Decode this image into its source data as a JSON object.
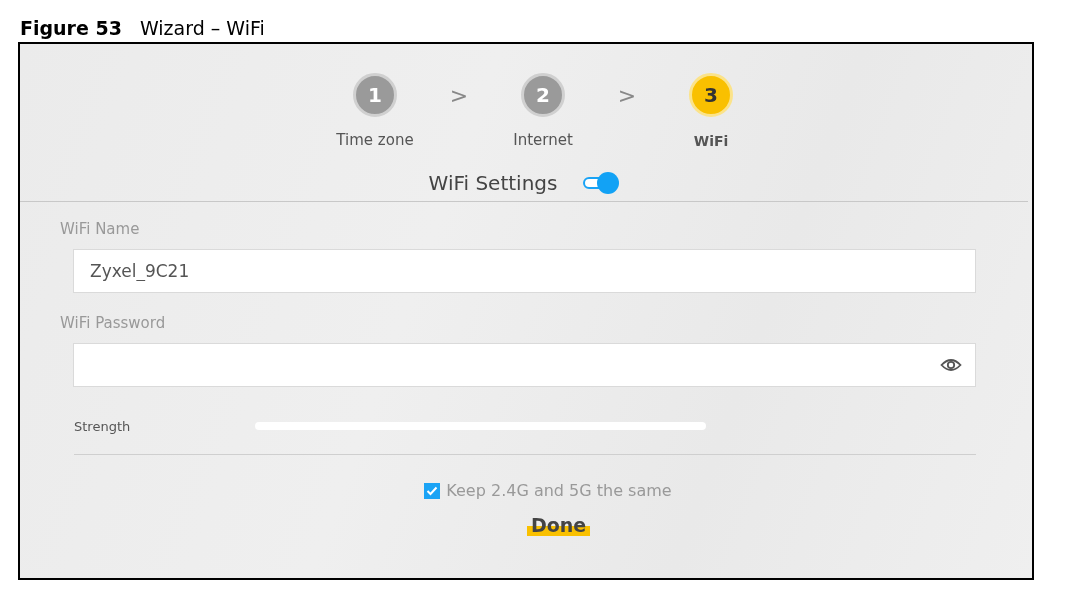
{
  "caption": {
    "number": "Figure 53",
    "title": "Wizard – WiFi"
  },
  "steps": [
    {
      "number": "1",
      "label": "Time zone",
      "selected": false
    },
    {
      "number": "2",
      "label": "Internet",
      "selected": false
    },
    {
      "number": "3",
      "label": "WiFi",
      "selected": true
    }
  ],
  "step_separator": ">",
  "section": {
    "title": "WiFi Settings",
    "on": true
  },
  "fields": [
    {
      "label": "WiFi Name",
      "value": "Zyxel_9C21",
      "kind": "text"
    },
    {
      "label": "WiFi Password",
      "kind": "password"
    }
  ],
  "strength": {
    "label": "Strength",
    "level": 0
  },
  "same_setting": {
    "label": "Keep 2.4G and 5G the same",
    "checked": true
  },
  "done_button": "Done"
}
